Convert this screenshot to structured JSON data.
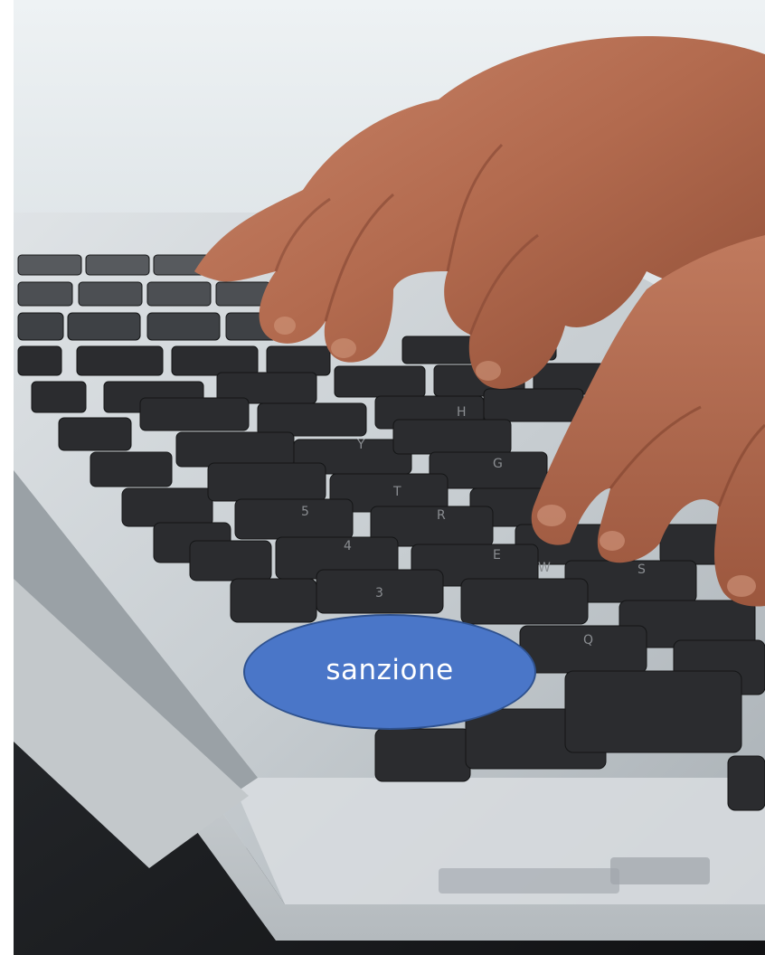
{
  "slide": {
    "background_color": "#ffffff",
    "photo": {
      "subject": "hands-typing-on-laptop-keyboard",
      "palette": {
        "backdrop": "#e6ebee",
        "chassis": "#c9cfd3",
        "key": "#2b2c2f",
        "skin": "#b26a4e",
        "shadow": "#1a1c1f"
      }
    },
    "callout": {
      "label": "sanzione",
      "fill_color": "#4a76c8",
      "border_color": "#2f528f",
      "text_color": "#ffffff"
    }
  }
}
